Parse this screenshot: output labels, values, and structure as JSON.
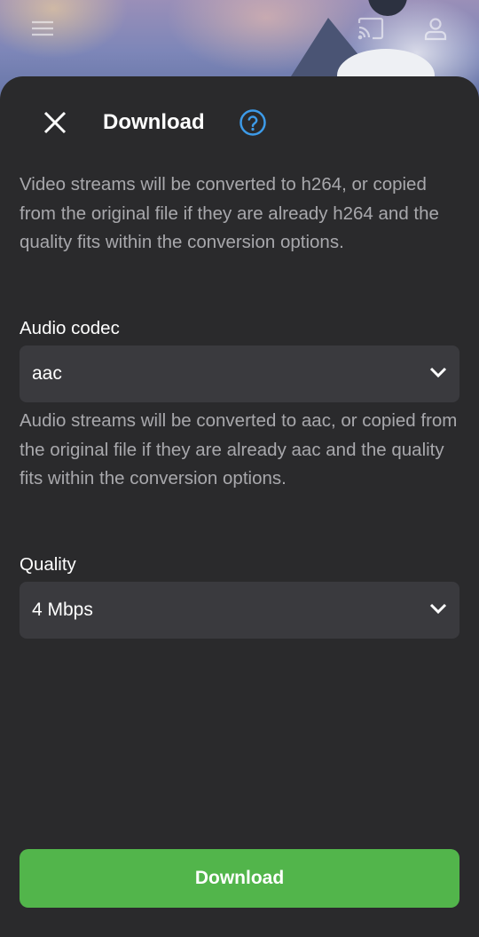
{
  "header": {
    "menu_icon": "hamburger-menu-icon",
    "cast_icon": "cast-icon",
    "user_icon": "user-icon"
  },
  "dialog": {
    "close_icon": "close-icon",
    "title": "Download",
    "help_icon": "help-icon",
    "video_description": "Video streams will be converted to h264, or copied from the original file if they are already h264 and the quality fits within the conversion options.",
    "audio_codec": {
      "label": "Audio codec",
      "value": "aac"
    },
    "audio_description": "Audio streams will be converted to aac, or copied from the original file if they are already aac and the quality fits within the conversion options.",
    "quality": {
      "label": "Quality",
      "value": "4 Mbps"
    },
    "download_label": "Download"
  },
  "colors": {
    "sheet_background": "#2a2a2c",
    "select_background": "#3a3a3e",
    "accent_green": "#52b54b",
    "help_blue": "#3d9be9",
    "muted_text": "#a8a8ac"
  }
}
